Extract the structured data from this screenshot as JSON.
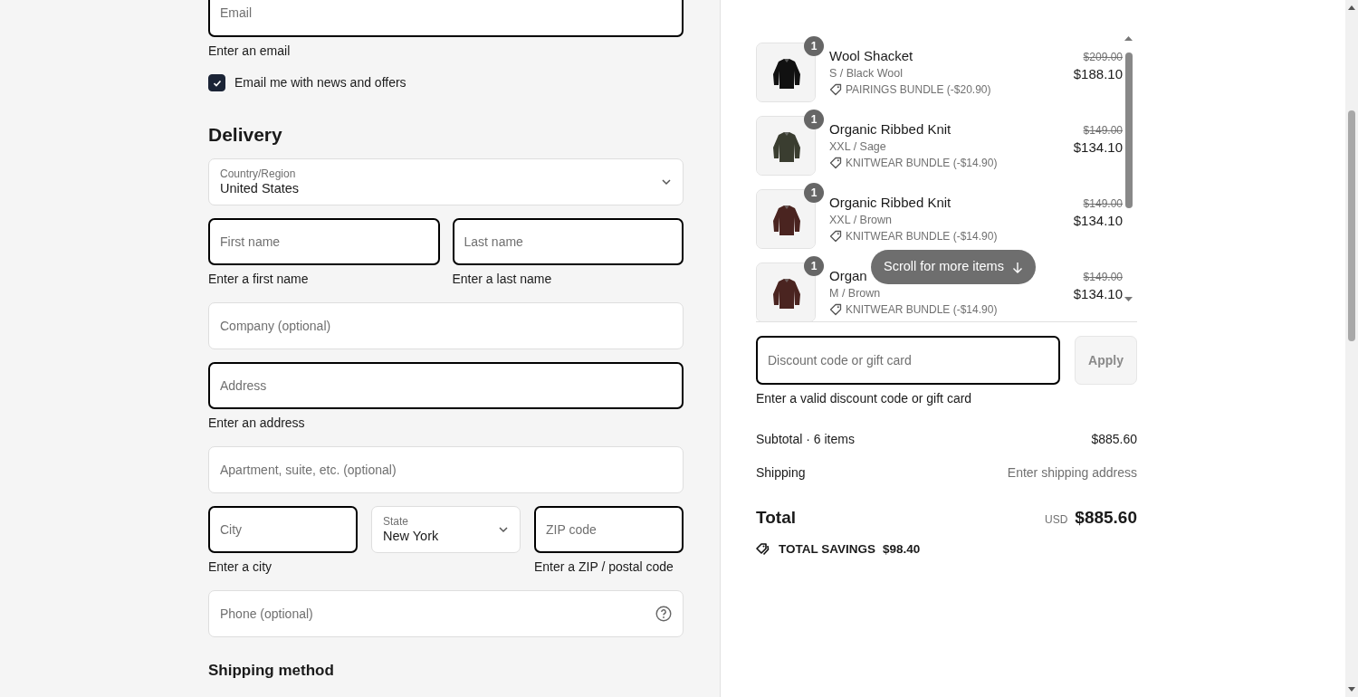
{
  "contact": {
    "email": {
      "placeholder": "Email",
      "invalid": true,
      "error": "Enter an email"
    },
    "newsletter": {
      "label": "Email me with news and offers",
      "checked": true
    }
  },
  "delivery": {
    "title": "Delivery",
    "rows": [
      [
        {
          "kind": "select",
          "label": "Country/Region",
          "value": "United States"
        }
      ],
      [
        {
          "kind": "text",
          "placeholder": "First name",
          "invalid": true,
          "error": "Enter a first name"
        },
        {
          "kind": "text",
          "placeholder": "Last name",
          "invalid": true,
          "error": "Enter a last name"
        }
      ],
      [
        {
          "kind": "text",
          "placeholder": "Company (optional)",
          "invalid": false
        }
      ],
      [
        {
          "kind": "text",
          "placeholder": "Address",
          "invalid": true,
          "error": "Enter an address"
        }
      ],
      [
        {
          "kind": "text",
          "placeholder": "Apartment, suite, etc. (optional)",
          "invalid": false
        }
      ],
      [
        {
          "kind": "text",
          "placeholder": "City",
          "invalid": true,
          "error": "Enter a city"
        },
        {
          "kind": "select",
          "label": "State",
          "value": "New York"
        },
        {
          "kind": "text",
          "placeholder": "ZIP code",
          "invalid": true,
          "error": "Enter a ZIP / postal code"
        }
      ],
      [
        {
          "kind": "phone",
          "placeholder": "Phone (optional)",
          "invalid": false
        }
      ]
    ]
  },
  "shipping_method": {
    "title": "Shipping method"
  },
  "cart": {
    "items": [
      {
        "quantity": "1",
        "name": "Wool Shacket",
        "variant": "S / Black Wool",
        "discount": "PAIRINGS BUNDLE (-$20.90)",
        "original_price": "$209.00",
        "price": "$188.10"
      },
      {
        "quantity": "1",
        "name": "Organic Ribbed Knit",
        "variant": "XXL / Sage",
        "discount": "KNITWEAR BUNDLE (-$14.90)",
        "original_price": "$149.00",
        "price": "$134.10"
      },
      {
        "quantity": "1",
        "name": "Organic Ribbed Knit",
        "variant": "XXL / Brown",
        "discount": "KNITWEAR BUNDLE (-$14.90)",
        "original_price": "$149.00",
        "price": "$134.10"
      },
      {
        "quantity": "1",
        "name": "Organ",
        "variant": "M / Brown",
        "discount": "KNITWEAR BUNDLE (-$14.90)",
        "original_price": "$149.00",
        "price": "$134.10"
      }
    ],
    "scroll_hint": "Scroll for more items"
  },
  "discount": {
    "placeholder": "Discount code or gift card",
    "invalid": true,
    "error": "Enter a valid discount code or gift card",
    "button": {
      "label": "Apply",
      "disabled": true
    }
  },
  "summary": {
    "subtotal_label": "Subtotal · 6 items",
    "subtotal": "$885.60",
    "shipping_label": "Shipping",
    "shipping": "Enter shipping address",
    "total_label": "Total",
    "currency": "USD",
    "total": "$885.60",
    "savings_label": "TOTAL SAVINGS",
    "savings": "$98.40"
  }
}
